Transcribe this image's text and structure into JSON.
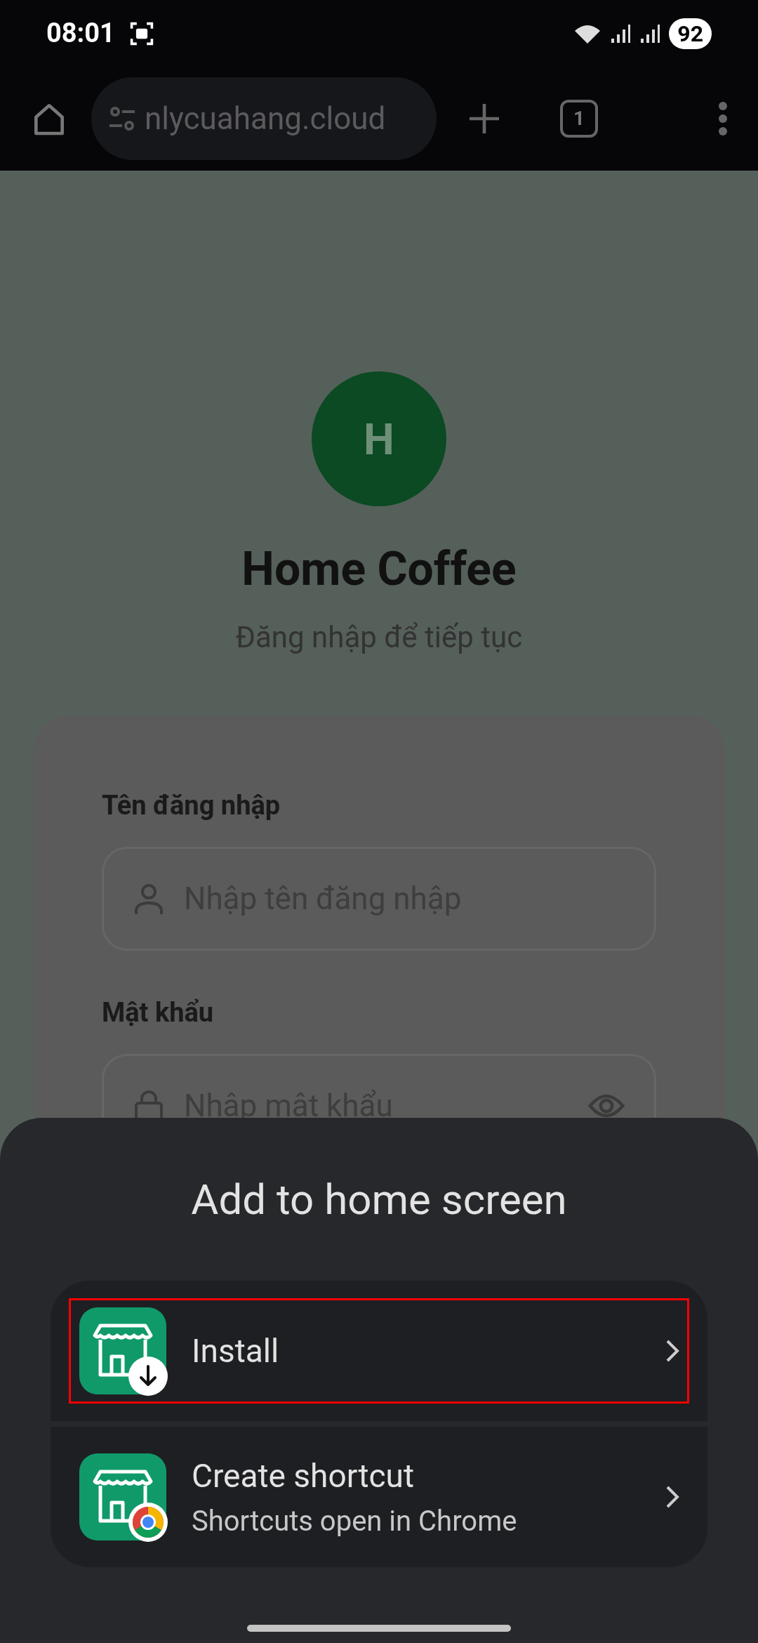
{
  "status_bar": {
    "time": "08:01",
    "battery": "92"
  },
  "browser_toolbar": {
    "url": "nlycuahang.cloud",
    "tab_count": "1"
  },
  "page": {
    "avatar_letter": "H",
    "title": "Home Coffee",
    "subtitle": "Đăng nhập để tiếp tục",
    "fields": [
      {
        "label": "Tên đăng nhập",
        "placeholder": "Nhập tên đăng nhập",
        "kind": "user"
      },
      {
        "label": "Mật khẩu",
        "placeholder": "Nhập mật khẩu",
        "kind": "password"
      }
    ]
  },
  "sheet": {
    "title": "Add to home screen",
    "options": [
      {
        "label": "Install",
        "kind": "install",
        "highlighted": true
      },
      {
        "label": "Create shortcut",
        "subtitle": "Shortcuts open in Chrome",
        "kind": "shortcut",
        "highlighted": false
      }
    ]
  }
}
